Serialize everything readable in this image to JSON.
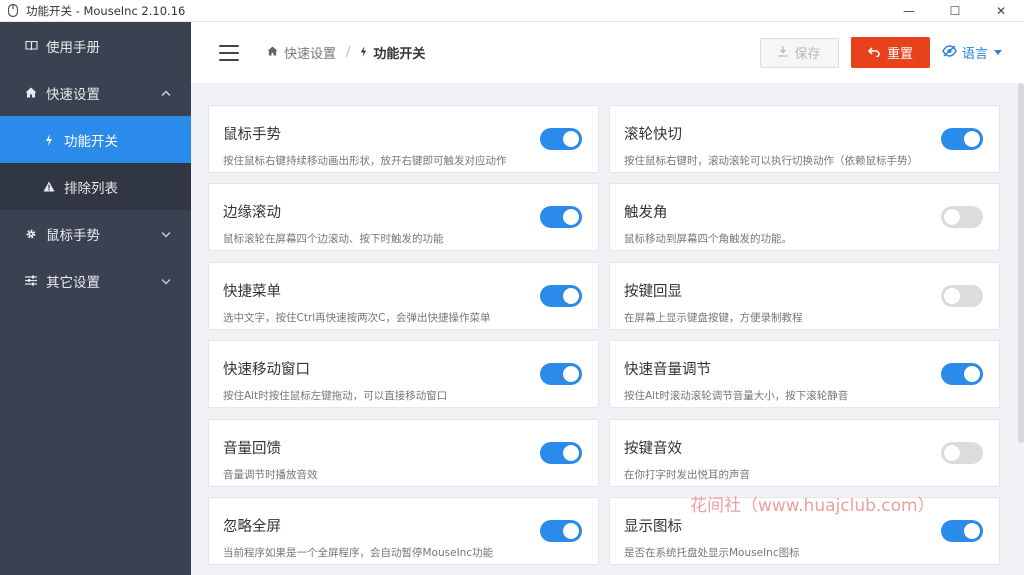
{
  "window": {
    "title": "功能开关 - MouseInc 2.10.16",
    "controls": {
      "minimize": "—",
      "maximize": "☐",
      "close": "✕"
    }
  },
  "sidebar": {
    "items": [
      {
        "label": "使用手册",
        "icon": "book-icon"
      },
      {
        "label": "快速设置",
        "icon": "home-icon",
        "expanded": true
      },
      {
        "label": "功能开关",
        "icon": "bolt-icon",
        "active": true
      },
      {
        "label": "排除列表",
        "icon": "warning-icon"
      },
      {
        "label": "鼠标手势",
        "icon": "gear-icon"
      },
      {
        "label": "其它设置",
        "icon": "sliders-icon"
      }
    ]
  },
  "header": {
    "breadcrumb": {
      "parent": "快速设置",
      "separator": "/",
      "current": "功能开关"
    },
    "save_label": "保存",
    "reset_label": "重置",
    "language_label": "语言"
  },
  "features": [
    {
      "title": "鼠标手势",
      "desc": "按住鼠标右键持续移动画出形状，放开右键即可触发对应动作",
      "enabled": true
    },
    {
      "title": "滚轮快切",
      "desc": "按住鼠标右键时，滚动滚轮可以执行切换动作（依赖鼠标手势）",
      "enabled": true
    },
    {
      "title": "边缘滚动",
      "desc": "鼠标滚轮在屏幕四个边滚动、按下时触发的功能",
      "enabled": true
    },
    {
      "title": "触发角",
      "desc": "鼠标移动到屏幕四个角触发的功能。",
      "enabled": false
    },
    {
      "title": "快捷菜单",
      "desc": "选中文字，按住Ctrl再快速按两次C，会弹出快捷操作菜单",
      "enabled": true
    },
    {
      "title": "按键回显",
      "desc": "在屏幕上显示键盘按键，方便录制教程",
      "enabled": false
    },
    {
      "title": "快速移动窗口",
      "desc": "按住Alt时按住鼠标左键拖动，可以直接移动窗口",
      "enabled": true
    },
    {
      "title": "快速音量调节",
      "desc": "按住Alt时滚动滚轮调节音量大小，按下滚轮静音",
      "enabled": true
    },
    {
      "title": "音量回馈",
      "desc": "音量调节时播放音效",
      "enabled": true
    },
    {
      "title": "按键音效",
      "desc": "在你打字时发出悦耳的声音",
      "enabled": false
    },
    {
      "title": "忽略全屏",
      "desc": "当前程序如果是一个全屏程序，会自动暂停MouseInc功能",
      "enabled": true
    },
    {
      "title": "显示图标",
      "desc": "是否在系统托盘处显示MouseInc图标",
      "enabled": true
    }
  ],
  "watermark": "花间社（www.huajclub.com）",
  "colors": {
    "accent": "#2a8bea",
    "sidebar": "#3a4150",
    "reset": "#e8421c",
    "toggle_off": "#dcdcdc"
  }
}
